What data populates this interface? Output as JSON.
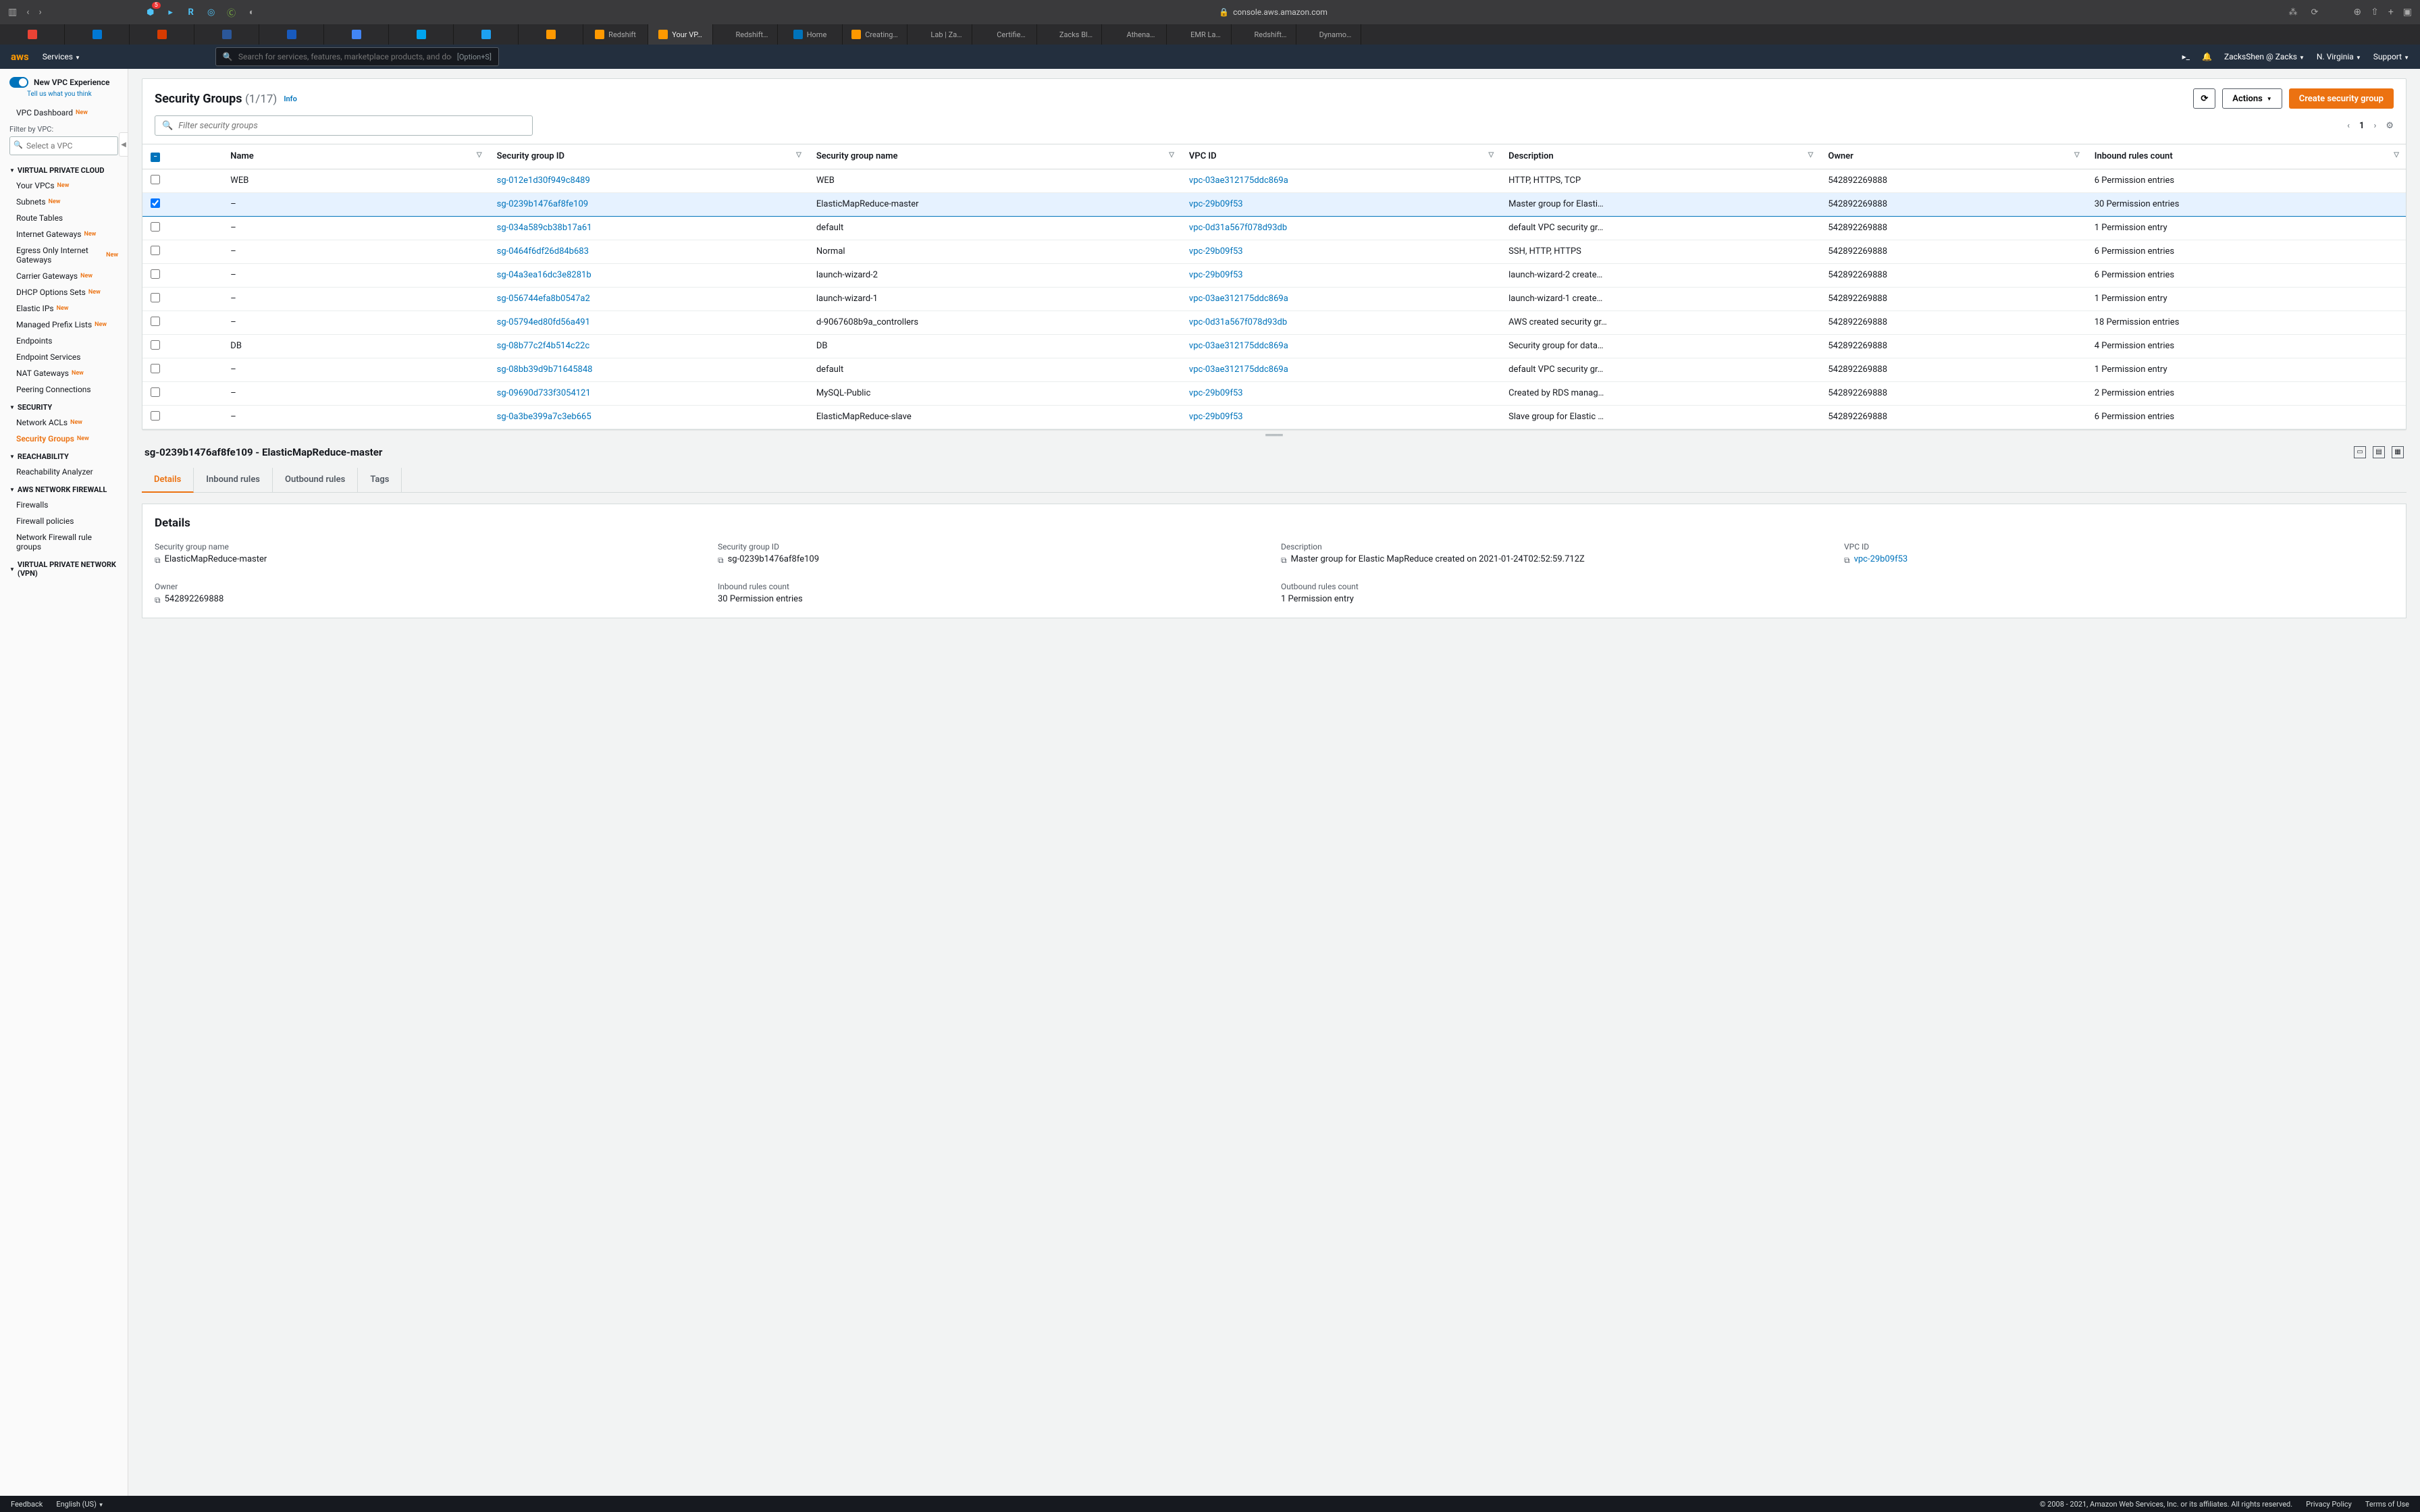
{
  "browser": {
    "url_lock": "🔒",
    "url": "console.aws.amazon.com",
    "ext_icons": [
      "person",
      "play",
      "R",
      "target",
      "C",
      "shield"
    ],
    "right_icons": [
      "download",
      "share",
      "plus",
      "tabs"
    ]
  },
  "tab_strip": [
    {
      "label": "",
      "fav": "#ea4335"
    },
    {
      "label": "",
      "fav": "#0078d4"
    },
    {
      "label": "",
      "fav": "#d83b01"
    },
    {
      "label": "",
      "fav": "#2b579a"
    },
    {
      "label": "",
      "fav": "#185abd"
    },
    {
      "label": "",
      "fav": "#4285f4"
    },
    {
      "label": "",
      "fav": "#00a4ef"
    },
    {
      "label": "",
      "fav": "#1da1f2"
    },
    {
      "label": "",
      "fav": "#ff9900"
    },
    {
      "label": "Redshift",
      "fav": "#ff9900"
    },
    {
      "label": "Your VP…",
      "fav": "#ff9900",
      "active": true
    },
    {
      "label": "Redshift…",
      "fav": ""
    },
    {
      "label": "Home",
      "fav": "#0073bb"
    },
    {
      "label": "Creating…",
      "fav": "#ff9900"
    },
    {
      "label": "Lab | Za…",
      "fav": ""
    },
    {
      "label": "Certifie…",
      "fav": ""
    },
    {
      "label": "Zacks Bl…",
      "fav": ""
    },
    {
      "label": "Athena…",
      "fav": ""
    },
    {
      "label": "EMR La…",
      "fav": ""
    },
    {
      "label": "Redshift…",
      "fav": ""
    },
    {
      "label": "Dynamo…",
      "fav": ""
    }
  ],
  "aws_header": {
    "logo": "aws",
    "services": "Services",
    "search_placeholder": "Search for services, features, marketplace products, and docs",
    "search_kbd": "[Option+S]",
    "account": "ZacksShen @ Zacks",
    "region": "N. Virginia",
    "support": "Support"
  },
  "sidebar": {
    "vpc_experience": "New VPC Experience",
    "vpc_experience_sub": "Tell us what you think",
    "dashboard": "VPC Dashboard",
    "filter_label": "Filter by VPC:",
    "filter_placeholder": "Select a VPC",
    "sections": [
      {
        "title": "VIRTUAL PRIVATE CLOUD",
        "items": [
          {
            "label": "Your VPCs",
            "new": true
          },
          {
            "label": "Subnets",
            "new": true
          },
          {
            "label": "Route Tables"
          },
          {
            "label": "Internet Gateways",
            "new": true
          },
          {
            "label": "Egress Only Internet Gateways",
            "new": true
          },
          {
            "label": "Carrier Gateways",
            "new": true
          },
          {
            "label": "DHCP Options Sets",
            "new": true
          },
          {
            "label": "Elastic IPs",
            "new": true
          },
          {
            "label": "Managed Prefix Lists",
            "new": true
          },
          {
            "label": "Endpoints"
          },
          {
            "label": "Endpoint Services"
          },
          {
            "label": "NAT Gateways",
            "new": true
          },
          {
            "label": "Peering Connections"
          }
        ]
      },
      {
        "title": "SECURITY",
        "items": [
          {
            "label": "Network ACLs",
            "new": true
          },
          {
            "label": "Security Groups",
            "new": true,
            "active": true
          }
        ]
      },
      {
        "title": "REACHABILITY",
        "items": [
          {
            "label": "Reachability Analyzer"
          }
        ]
      },
      {
        "title": "AWS NETWORK FIREWALL",
        "items": [
          {
            "label": "Firewalls"
          },
          {
            "label": "Firewall policies"
          },
          {
            "label": "Network Firewall rule groups"
          }
        ]
      },
      {
        "title": "VIRTUAL PRIVATE NETWORK (VPN)",
        "items": []
      }
    ]
  },
  "page": {
    "title": "Security Groups",
    "count": "(1/17)",
    "info": "Info",
    "refresh": "⟳",
    "actions": "Actions",
    "create": "Create security group",
    "filter_placeholder": "Filter security groups",
    "page_num": "1",
    "columns": [
      "Name",
      "Security group ID",
      "Security group name",
      "VPC ID",
      "Description",
      "Owner",
      "Inbound rules count"
    ],
    "rows": [
      {
        "sel": false,
        "name": "WEB",
        "sgid": "sg-012e1d30f949c8489",
        "sgname": "WEB",
        "vpc": "vpc-03ae312175ddc869a",
        "desc": "HTTP, HTTPS, TCP",
        "owner": "542892269888",
        "inb": "6 Permission entries"
      },
      {
        "sel": true,
        "name": "–",
        "sgid": "sg-0239b1476af8fe109",
        "sgname": "ElasticMapReduce-master",
        "vpc": "vpc-29b09f53",
        "desc": "Master group for Elasti…",
        "owner": "542892269888",
        "inb": "30 Permission entries"
      },
      {
        "sel": false,
        "name": "–",
        "sgid": "sg-034a589cb38b17a61",
        "sgname": "default",
        "vpc": "vpc-0d31a567f078d93db",
        "desc": "default VPC security gr…",
        "owner": "542892269888",
        "inb": "1 Permission entry"
      },
      {
        "sel": false,
        "name": "–",
        "sgid": "sg-0464f6df26d84b683",
        "sgname": "Normal",
        "vpc": "vpc-29b09f53",
        "desc": "SSH, HTTP, HTTPS",
        "owner": "542892269888",
        "inb": "6 Permission entries"
      },
      {
        "sel": false,
        "name": "–",
        "sgid": "sg-04a3ea16dc3e8281b",
        "sgname": "launch-wizard-2",
        "vpc": "vpc-29b09f53",
        "desc": "launch-wizard-2 create…",
        "owner": "542892269888",
        "inb": "6 Permission entries"
      },
      {
        "sel": false,
        "name": "–",
        "sgid": "sg-056744efa8b0547a2",
        "sgname": "launch-wizard-1",
        "vpc": "vpc-03ae312175ddc869a",
        "desc": "launch-wizard-1 create…",
        "owner": "542892269888",
        "inb": "1 Permission entry"
      },
      {
        "sel": false,
        "name": "–",
        "sgid": "sg-05794ed80fd56a491",
        "sgname": "d-9067608b9a_controllers",
        "vpc": "vpc-0d31a567f078d93db",
        "desc": "AWS created security gr…",
        "owner": "542892269888",
        "inb": "18 Permission entries"
      },
      {
        "sel": false,
        "name": "DB",
        "sgid": "sg-08b77c2f4b514c22c",
        "sgname": "DB",
        "vpc": "vpc-03ae312175ddc869a",
        "desc": "Security group for data…",
        "owner": "542892269888",
        "inb": "4 Permission entries"
      },
      {
        "sel": false,
        "name": "–",
        "sgid": "sg-08bb39d9b71645848",
        "sgname": "default",
        "vpc": "vpc-03ae312175ddc869a",
        "desc": "default VPC security gr…",
        "owner": "542892269888",
        "inb": "1 Permission entry"
      },
      {
        "sel": false,
        "name": "–",
        "sgid": "sg-09690d733f3054121",
        "sgname": "MySQL-Public",
        "vpc": "vpc-29b09f53",
        "desc": "Created by RDS manag…",
        "owner": "542892269888",
        "inb": "2 Permission entries"
      },
      {
        "sel": false,
        "name": "–",
        "sgid": "sg-0a3be399a7c3eb665",
        "sgname": "ElasticMapReduce-slave",
        "vpc": "vpc-29b09f53",
        "desc": "Slave group for Elastic …",
        "owner": "542892269888",
        "inb": "6 Permission entries"
      }
    ]
  },
  "detail": {
    "header": "sg-0239b1476af8fe109 - ElasticMapReduce-master",
    "tabs": [
      "Details",
      "Inbound rules",
      "Outbound rules",
      "Tags"
    ],
    "panel_title": "Details",
    "items": [
      {
        "lbl": "Security group name",
        "val": "ElasticMapReduce-master",
        "copy": true
      },
      {
        "lbl": "Security group ID",
        "val": "sg-0239b1476af8fe109",
        "copy": true
      },
      {
        "lbl": "Description",
        "val": "Master group for Elastic MapReduce created on 2021-01-24T02:52:59.712Z",
        "copy": true
      },
      {
        "lbl": "VPC ID",
        "val": "vpc-29b09f53",
        "copy": true,
        "link": true
      },
      {
        "lbl": "Owner",
        "val": "542892269888",
        "copy": true
      },
      {
        "lbl": "Inbound rules count",
        "val": "30 Permission entries"
      },
      {
        "lbl": "Outbound rules count",
        "val": "1 Permission entry"
      }
    ]
  },
  "footer": {
    "feedback": "Feedback",
    "lang": "English (US)",
    "copyright": "© 2008 - 2021, Amazon Web Services, Inc. or its affiliates. All rights reserved.",
    "privacy": "Privacy Policy",
    "terms": "Terms of Use"
  }
}
